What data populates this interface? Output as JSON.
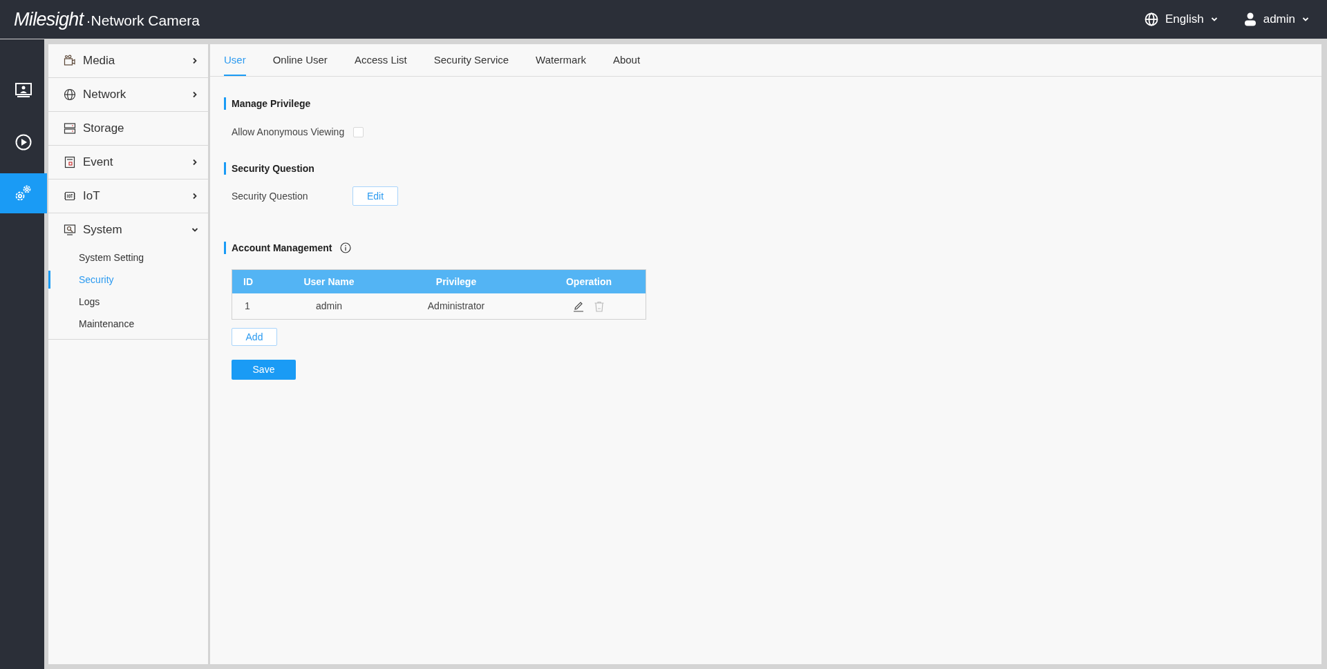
{
  "header": {
    "brand": "Milesight",
    "product": "·Network Camera",
    "language": "English",
    "user": "admin"
  },
  "rail": [
    {
      "selected": false
    },
    {
      "selected": false
    },
    {
      "selected": true
    }
  ],
  "menu": [
    {
      "label": "Media",
      "expandable": true,
      "expanded": false
    },
    {
      "label": "Network",
      "expandable": true,
      "expanded": false
    },
    {
      "label": "Storage",
      "expandable": false
    },
    {
      "label": "Event",
      "expandable": true,
      "expanded": false
    },
    {
      "label": "IoT",
      "expandable": true,
      "expanded": false
    },
    {
      "label": "System",
      "expandable": true,
      "expanded": true,
      "children": [
        {
          "label": "System Setting",
          "selected": false
        },
        {
          "label": "Security",
          "selected": true
        },
        {
          "label": "Logs",
          "selected": false
        },
        {
          "label": "Maintenance",
          "selected": false
        }
      ]
    }
  ],
  "tabs": [
    {
      "label": "User",
      "selected": true
    },
    {
      "label": "Online User",
      "selected": false
    },
    {
      "label": "Access List",
      "selected": false
    },
    {
      "label": "Security Service",
      "selected": false
    },
    {
      "label": "Watermark",
      "selected": false
    },
    {
      "label": "About",
      "selected": false
    }
  ],
  "manage_privilege": {
    "title": "Manage Privilege",
    "label": "Allow Anonymous Viewing",
    "checked": false
  },
  "security_question": {
    "title": "Security Question",
    "label": "Security Question",
    "button": "Edit"
  },
  "account_management": {
    "title": "Account Management",
    "columns": [
      "ID",
      "User Name",
      "Privilege",
      "Operation"
    ],
    "rows": [
      {
        "id": "1",
        "user_name": "admin",
        "privilege": "Administrator",
        "delete_disabled": true
      }
    ],
    "add_button": "Add"
  },
  "save_button": "Save"
}
